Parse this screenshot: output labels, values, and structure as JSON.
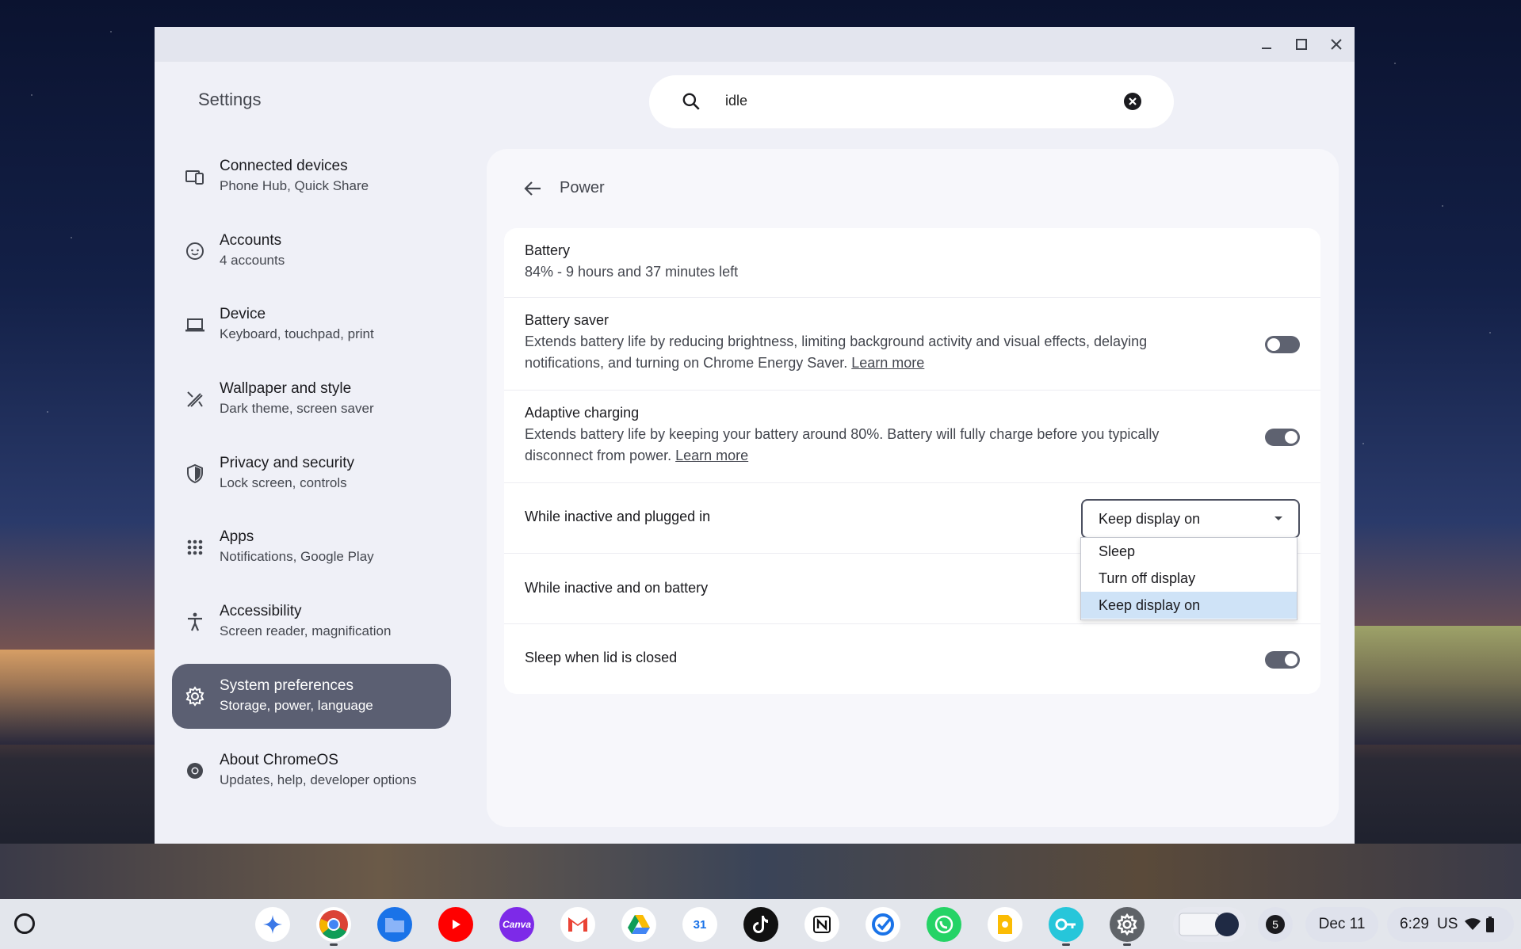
{
  "window": {
    "app_title": "Settings"
  },
  "search": {
    "value": "idle"
  },
  "sidebar": {
    "items": [
      {
        "title": "Connected devices",
        "subtitle": "Phone Hub, Quick Share",
        "icon": "devices-icon"
      },
      {
        "title": "Accounts",
        "subtitle": "4 accounts",
        "icon": "account-icon"
      },
      {
        "title": "Device",
        "subtitle": "Keyboard, touchpad, print",
        "icon": "laptop-icon"
      },
      {
        "title": "Wallpaper and style",
        "subtitle": "Dark theme, screen saver",
        "icon": "paint-icon"
      },
      {
        "title": "Privacy and security",
        "subtitle": "Lock screen, controls",
        "icon": "shield-icon"
      },
      {
        "title": "Apps",
        "subtitle": "Notifications, Google Play",
        "icon": "apps-grid-icon"
      },
      {
        "title": "Accessibility",
        "subtitle": "Screen reader, magnification",
        "icon": "accessibility-icon"
      },
      {
        "title": "System preferences",
        "subtitle": "Storage, power, language",
        "icon": "gear-icon",
        "active": true
      },
      {
        "title": "About ChromeOS",
        "subtitle": "Updates, help, developer options",
        "icon": "chromeos-icon"
      }
    ]
  },
  "power": {
    "page_title": "Power",
    "battery": {
      "title": "Battery",
      "status": "84% - 9 hours and 37 minutes left"
    },
    "battery_saver": {
      "title": "Battery saver",
      "description": "Extends battery life by reducing brightness, limiting background activity and visual effects, delaying notifications, and turning on Chrome Energy Saver.",
      "link": "Learn more",
      "enabled": false
    },
    "adaptive_charging": {
      "title": "Adaptive charging",
      "description": "Extends battery life by keeping your battery around 80%. Battery will fully charge before you typically disconnect from power.",
      "link": "Learn more",
      "enabled": true
    },
    "inactive_plugged": {
      "title": "While inactive and plugged in",
      "selected": "Keep display on",
      "options": [
        "Sleep",
        "Turn off display",
        "Keep display on"
      ]
    },
    "inactive_battery": {
      "title": "While inactive and on battery"
    },
    "lid_sleep": {
      "title": "Sleep when lid is closed",
      "enabled": true
    }
  },
  "shelf": {
    "apps": [
      "Gemini",
      "Chrome",
      "Files",
      "YouTube",
      "Canva",
      "Gmail",
      "Google Drive",
      "Google Calendar",
      "TikTok",
      "Notion",
      "Tasks",
      "WhatsApp",
      "Google Keep",
      "Password Manager",
      "Settings"
    ],
    "canva_label": "Canva",
    "calendar_label": "31",
    "notification_count": "5",
    "date": "Dec 11",
    "time": "6:29",
    "locale": "US"
  }
}
